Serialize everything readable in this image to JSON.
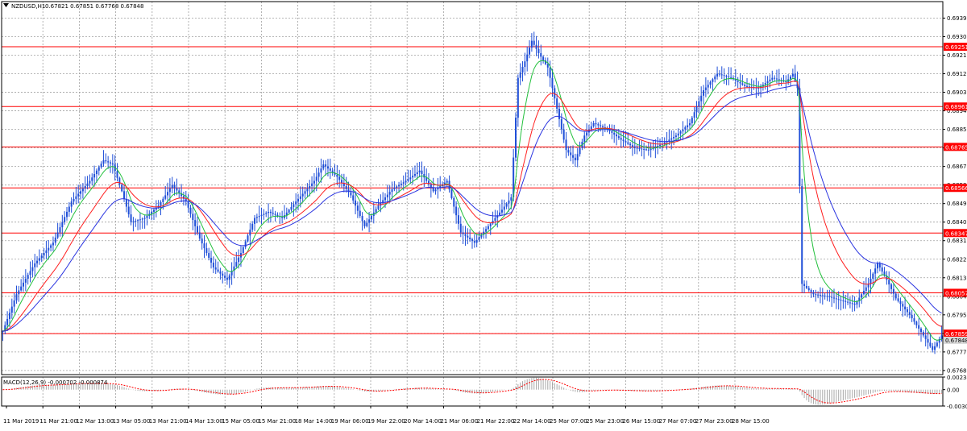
{
  "header": {
    "symbol_label": "NZDUSD,H1",
    "ohlc_text": "0.67821 0.67851 0.67768 0.67848",
    "menu_icon": "triangle-down-icon"
  },
  "colors": {
    "candles": "#1f4fd8",
    "ma_fast": "#22c03c",
    "ma_mid": "#ff2020",
    "ma_slow": "#2a34e0",
    "levels": "#ff0000",
    "grid": "#a0a0a0",
    "macd_hist": "#a8a8a8",
    "macd_signal": "#ff0000",
    "frame": "#000000"
  },
  "chart_data": {
    "type": "candlestick",
    "symbol": "NZDUSD",
    "timeframe": "H1",
    "y_axis_ticks": [
      "0.69390",
      "0.69300",
      "0.69210",
      "0.69120",
      "0.69030",
      "0.68940",
      "0.68850",
      "0.68760",
      "0.68670",
      "0.68580",
      "0.68490",
      "0.68400",
      "0.68310",
      "0.68220",
      "0.68130",
      "0.68040",
      "0.67950",
      "0.67860",
      "0.67770",
      "0.67680"
    ],
    "ylim": [
      0.6766,
      0.6947
    ],
    "x_axis_labels": [
      "11 Mar 2019",
      "11 Mar 21:00",
      "12 Mar 13:00",
      "13 Mar 05:00",
      "13 Mar 21:00",
      "14 Mar 13:00",
      "15 Mar 05:00",
      "15 Mar 21:00",
      "18 Mar 14:00",
      "19 Mar 06:00",
      "19 Mar 22:00",
      "20 Mar 14:00",
      "21 Mar 06:00",
      "21 Mar 22:00",
      "22 Mar 14:00",
      "25 Mar 07:00",
      "25 Mar 23:00",
      "26 Mar 15:00",
      "27 Mar 07:00",
      "27 Mar 23:00",
      "28 Mar 15:00"
    ],
    "price_levels": [
      {
        "label": "0.69251",
        "value": 0.69251
      },
      {
        "label": "0.68961",
        "value": 0.68961
      },
      {
        "label": "0.68765",
        "value": 0.68765
      },
      {
        "label": "0.68566",
        "value": 0.68566
      },
      {
        "label": "0.68347",
        "value": 0.68347
      },
      {
        "label": "0.68057",
        "value": 0.68057
      },
      {
        "label": "0.67859",
        "value": 0.67859
      }
    ],
    "current_price": {
      "label": "0.67848",
      "value": 0.67848
    },
    "close_path": [
      [
        0,
        0.6787
      ],
      [
        6,
        0.6805
      ],
      [
        14,
        0.682
      ],
      [
        22,
        0.683
      ],
      [
        30,
        0.685
      ],
      [
        38,
        0.686
      ],
      [
        44,
        0.687
      ],
      [
        48,
        0.6868
      ],
      [
        52,
        0.6855
      ],
      [
        56,
        0.684
      ],
      [
        62,
        0.6842
      ],
      [
        68,
        0.6848
      ],
      [
        74,
        0.6858
      ],
      [
        80,
        0.685
      ],
      [
        86,
        0.6832
      ],
      [
        92,
        0.6818
      ],
      [
        98,
        0.6812
      ],
      [
        104,
        0.6825
      ],
      [
        110,
        0.6842
      ],
      [
        116,
        0.6845
      ],
      [
        122,
        0.6842
      ],
      [
        128,
        0.685
      ],
      [
        136,
        0.686
      ],
      [
        140,
        0.6868
      ],
      [
        146,
        0.6862
      ],
      [
        152,
        0.6853
      ],
      [
        158,
        0.6838
      ],
      [
        164,
        0.6848
      ],
      [
        170,
        0.6856
      ],
      [
        176,
        0.686
      ],
      [
        182,
        0.6865
      ],
      [
        188,
        0.6855
      ],
      [
        194,
        0.686
      ],
      [
        200,
        0.6835
      ],
      [
        206,
        0.683
      ],
      [
        212,
        0.6838
      ],
      [
        218,
        0.6846
      ],
      [
        222,
        0.6852
      ],
      [
        225,
        0.691
      ],
      [
        228,
        0.6918
      ],
      [
        231,
        0.6928
      ],
      [
        234,
        0.6922
      ],
      [
        238,
        0.6915
      ],
      [
        242,
        0.6895
      ],
      [
        246,
        0.6875
      ],
      [
        250,
        0.687
      ],
      [
        254,
        0.6882
      ],
      [
        258,
        0.6888
      ],
      [
        264,
        0.6885
      ],
      [
        270,
        0.688
      ],
      [
        276,
        0.6876
      ],
      [
        282,
        0.6875
      ],
      [
        288,
        0.6878
      ],
      [
        294,
        0.6882
      ],
      [
        300,
        0.6888
      ],
      [
        306,
        0.6904
      ],
      [
        312,
        0.6912
      ],
      [
        318,
        0.691
      ],
      [
        324,
        0.6906
      ],
      [
        330,
        0.6905
      ],
      [
        336,
        0.691
      ],
      [
        342,
        0.6908
      ],
      [
        345,
        0.6912
      ],
      [
        347,
        0.6905
      ],
      [
        349,
        0.681
      ],
      [
        354,
        0.6805
      ],
      [
        360,
        0.6804
      ],
      [
        366,
        0.6802
      ],
      [
        372,
        0.68
      ],
      [
        378,
        0.681
      ],
      [
        382,
        0.682
      ],
      [
        386,
        0.6812
      ],
      [
        390,
        0.6803
      ],
      [
        396,
        0.6795
      ],
      [
        402,
        0.6785
      ],
      [
        406,
        0.6778
      ],
      [
        410,
        0.6785
      ]
    ],
    "ma_periods": {
      "fast": 8,
      "mid": 21,
      "slow": 34
    },
    "bar_count": 411,
    "macd": {
      "label": "MACD(12,26,9) -0.000702 -0.000874",
      "ticks": [
        "0.002344",
        "0.00",
        "-0.003037"
      ],
      "ylim": [
        -0.003037,
        0.002344
      ]
    }
  }
}
